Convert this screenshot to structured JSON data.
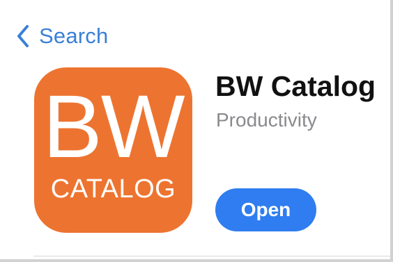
{
  "nav": {
    "back_label": "Search",
    "back_icon": "chevron-left-icon"
  },
  "app": {
    "icon": {
      "line1": "BW",
      "line2": "CATALOG",
      "background_color": "#ed7430"
    },
    "name": "BW Catalog",
    "category": "Productivity",
    "open_label": "Open"
  },
  "colors": {
    "accent": "#3a7fd8",
    "button": "#2f7df0",
    "secondary_text": "#8a8a8e"
  }
}
